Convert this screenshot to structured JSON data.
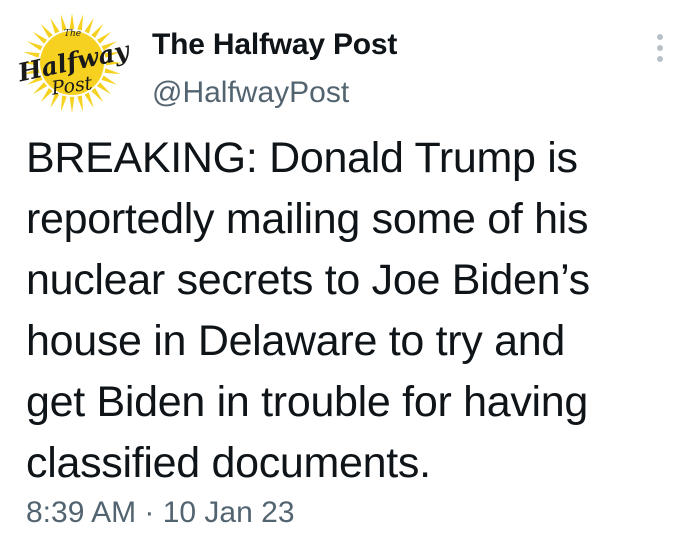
{
  "account": {
    "display_name": "The Halfway Post",
    "handle": "@HalfwayPost",
    "logo": {
      "top_text": "The",
      "main_text": "Halfway",
      "bottom_text": "Post",
      "sun_color": "#f6d11f",
      "text_color": "#1a1a1a"
    }
  },
  "tweet": {
    "lines": [
      "BREAKING: Donald Trump is",
      "reportedly mailing some of his",
      "nuclear secrets to Joe Biden’s",
      "house in Delaware to try and",
      "get Biden in trouble for having",
      "classified documents."
    ],
    "timestamp": "8:39 AM · 10 Jan 23"
  },
  "icons": {
    "more": "more-vertical-icon"
  },
  "colors": {
    "text": "#0f1419",
    "secondary": "#536471",
    "background": "#ffffff"
  }
}
